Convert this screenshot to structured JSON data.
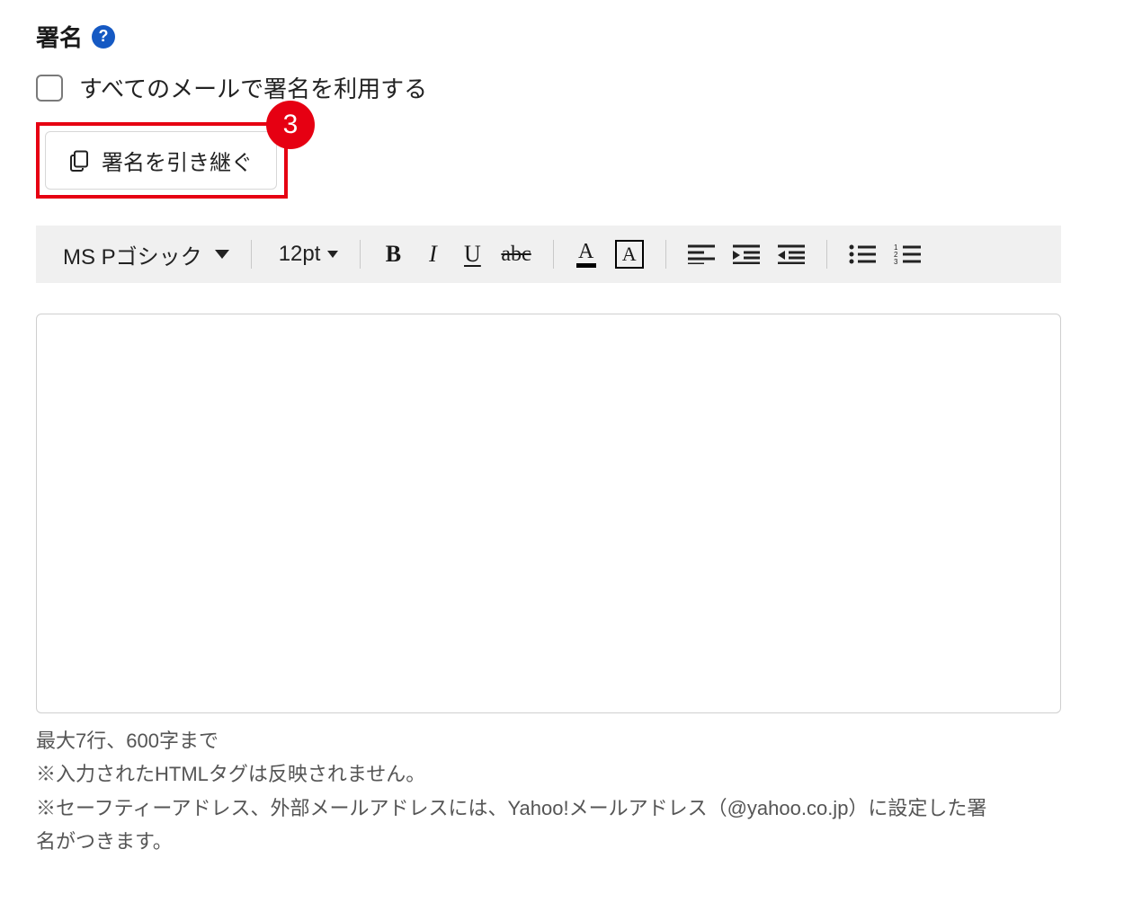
{
  "section": {
    "title": "署名",
    "help_glyph": "?"
  },
  "use_signature": {
    "label": "すべてのメールで署名を利用する",
    "checked": false
  },
  "inherit": {
    "button_label": "署名を引き継ぐ",
    "step_number": "3"
  },
  "toolbar": {
    "font_family": "MS Pゴシック",
    "font_size": "12pt"
  },
  "editor": {
    "value": ""
  },
  "notes": {
    "limit": "最大7行、600字まで",
    "note_html": "※入力されたHTMLタグは反映されません。",
    "note_safety": "※セーフティーアドレス、外部メールアドレスには、Yahoo!メールアドレス（@yahoo.co.jp）に設定した署名がつきます。"
  }
}
